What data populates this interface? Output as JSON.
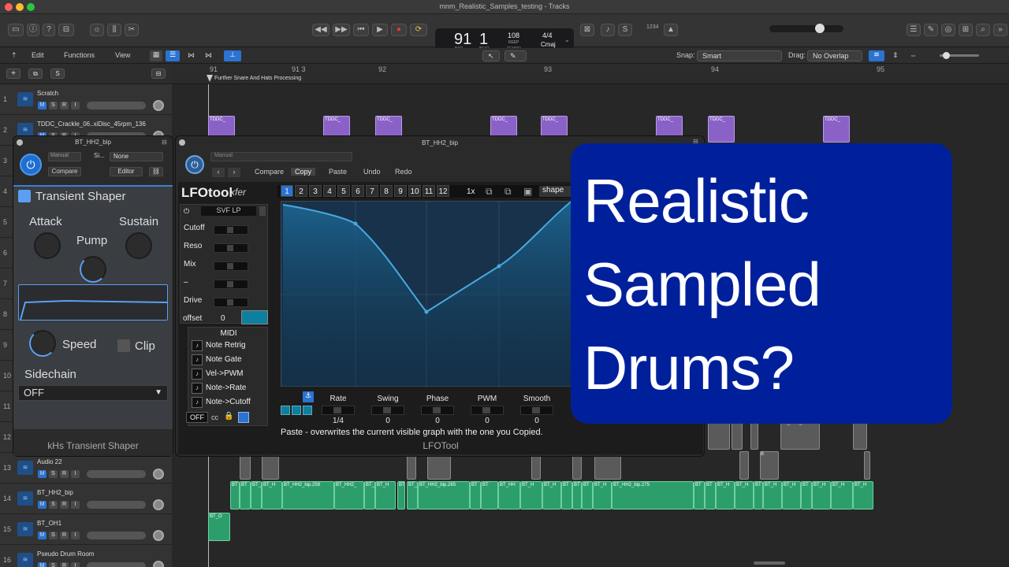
{
  "window": {
    "title": "mnm_Realistic_Samples_testing - Tracks"
  },
  "lcd": {
    "bar": "91",
    "beat": "1",
    "bar_label": "BAR",
    "beat_label": "BEAT",
    "tempo": "108",
    "tempo_mode": "KEEP",
    "tempo_label": "TEMPO",
    "signature": "4/4",
    "key": "Cmaj"
  },
  "control": {
    "count_in": "1234"
  },
  "toolbar": {
    "edit": "Edit",
    "functions": "Functions",
    "view": "View",
    "snap_label": "Snap:",
    "snap_value": "Smart",
    "drag_label": "Drag:",
    "drag_value": "No Overlap"
  },
  "ruler": {
    "marks": [
      "91",
      "91 3",
      "92",
      "93",
      "94",
      "95"
    ],
    "marker": "Further Snare And Hats Processing"
  },
  "tracks": [
    {
      "num": "1",
      "name": "Scratch"
    },
    {
      "num": "2",
      "name": "TDDC_Crackle_06..xiDisc_45rpm_136"
    },
    {
      "num": "3",
      "name": ""
    },
    {
      "num": "4",
      "name": ""
    },
    {
      "num": "5",
      "name": ""
    },
    {
      "num": "6",
      "name": ""
    },
    {
      "num": "7",
      "name": ""
    },
    {
      "num": "8",
      "name": ""
    },
    {
      "num": "9",
      "name": ""
    },
    {
      "num": "10",
      "name": ""
    },
    {
      "num": "11",
      "name": ""
    },
    {
      "num": "12",
      "name": ""
    },
    {
      "num": "13",
      "name": "Audio 22"
    },
    {
      "num": "14",
      "name": "BT_HH2_bip"
    },
    {
      "num": "15",
      "name": "BT_OH1"
    },
    {
      "num": "16",
      "name": "Pseudo Drum Room"
    }
  ],
  "msr": {
    "m": "M",
    "s": "S",
    "r": "R",
    "i": "I"
  },
  "regions": {
    "tddc": "TDDC_",
    "bt_o": "BT_O",
    "bt": "BT",
    "b": "B",
    "bt_h": "BT_H",
    "bt_hh": "BT_HH",
    "bt_hh2": "BT_HH2_",
    "bt_hh2_259": "BT_HH2_bip.259",
    "bt_hh2_265": "BT_HH2_bip.265",
    "bt_hh2_275": "BT_HH2_bip.275"
  },
  "transient_shaper": {
    "window_title": "BT_HH2_bip",
    "preset": "Manual",
    "side_label": "Si...",
    "side_value": "None",
    "compare": "Compare",
    "editor": "Editor",
    "title": "Transient Shaper",
    "attack": "Attack",
    "sustain": "Sustain",
    "pump": "Pump",
    "speed": "Speed",
    "clip": "Clip",
    "sidechain": "Sidechain",
    "sidechain_value": "OFF",
    "footer": "kHs Transient Shaper"
  },
  "lfotool": {
    "window_title": "BT_HH2_bip",
    "preset": "Manual",
    "compare": "Compare",
    "copy": "Copy",
    "paste": "Paste",
    "undo": "Undo",
    "redo": "Redo",
    "logo": "LFOtool",
    "brand": "xfer",
    "filter_type": "SVF LP",
    "params": [
      "Cutoff",
      "Reso",
      "Mix",
      "–",
      "Drive"
    ],
    "offset_label": "offset",
    "offset_value": "0",
    "midi_title": "MIDI",
    "midi_items": [
      "Note Retrig",
      "Note Gate",
      "Vel->PWM",
      "Note->Rate",
      "Note->Cutoff"
    ],
    "off": "OFF",
    "cc": "cc",
    "pages": [
      "1",
      "2",
      "3",
      "4",
      "5",
      "6",
      "7",
      "8",
      "9",
      "10",
      "11",
      "12"
    ],
    "speed": "1x",
    "shape": "shape",
    "bottom_params": [
      {
        "label": "Rate",
        "value": "1/4"
      },
      {
        "label": "Swing",
        "value": "0"
      },
      {
        "label": "Phase",
        "value": "0"
      },
      {
        "label": "PWM",
        "value": "0"
      },
      {
        "label": "Smooth",
        "value": "0"
      }
    ],
    "hint": "Paste - overwrites the current visible graph with the one you Copied.",
    "footer": "LFOTool"
  },
  "overlay": {
    "line1": "Realistic",
    "line2": "Sampled",
    "line3": "Drums?"
  }
}
